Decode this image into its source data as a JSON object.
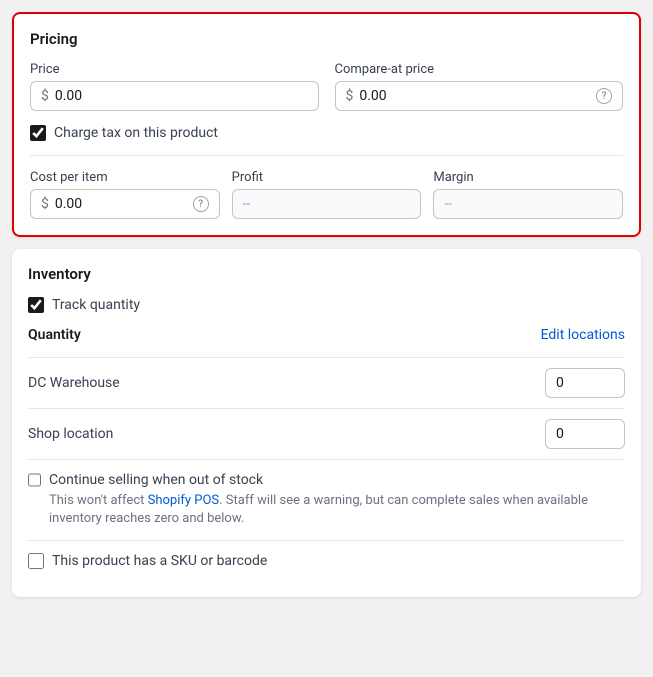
{
  "pricing": {
    "title": "Pricing",
    "price_label": "Price",
    "price_value": "0.00",
    "compare_at_price_label": "Compare-at price",
    "compare_at_price_value": "0.00",
    "currency_symbol": "$",
    "charge_tax_label": "Charge tax on this product",
    "charge_tax_checked": true,
    "cost_per_item_label": "Cost per item",
    "cost_per_item_value": "0.00",
    "profit_label": "Profit",
    "profit_value": "--",
    "margin_label": "Margin",
    "margin_value": "--"
  },
  "inventory": {
    "title": "Inventory",
    "track_quantity_label": "Track quantity",
    "track_quantity_checked": true,
    "quantity_label": "Quantity",
    "edit_locations_label": "Edit locations",
    "dc_warehouse_label": "DC Warehouse",
    "dc_warehouse_value": "0",
    "shop_location_label": "Shop location",
    "shop_location_value": "0",
    "continue_selling_label": "Continue selling when out of stock",
    "continue_selling_checked": false,
    "continue_selling_description_prefix": "This won't affect ",
    "shopify_pos_label": "Shopify POS",
    "continue_selling_description_suffix": ". Staff will see a warning, but can complete sales when available inventory reaches zero and below.",
    "sku_barcode_label": "This product has a SKU or barcode",
    "sku_barcode_checked": false
  }
}
